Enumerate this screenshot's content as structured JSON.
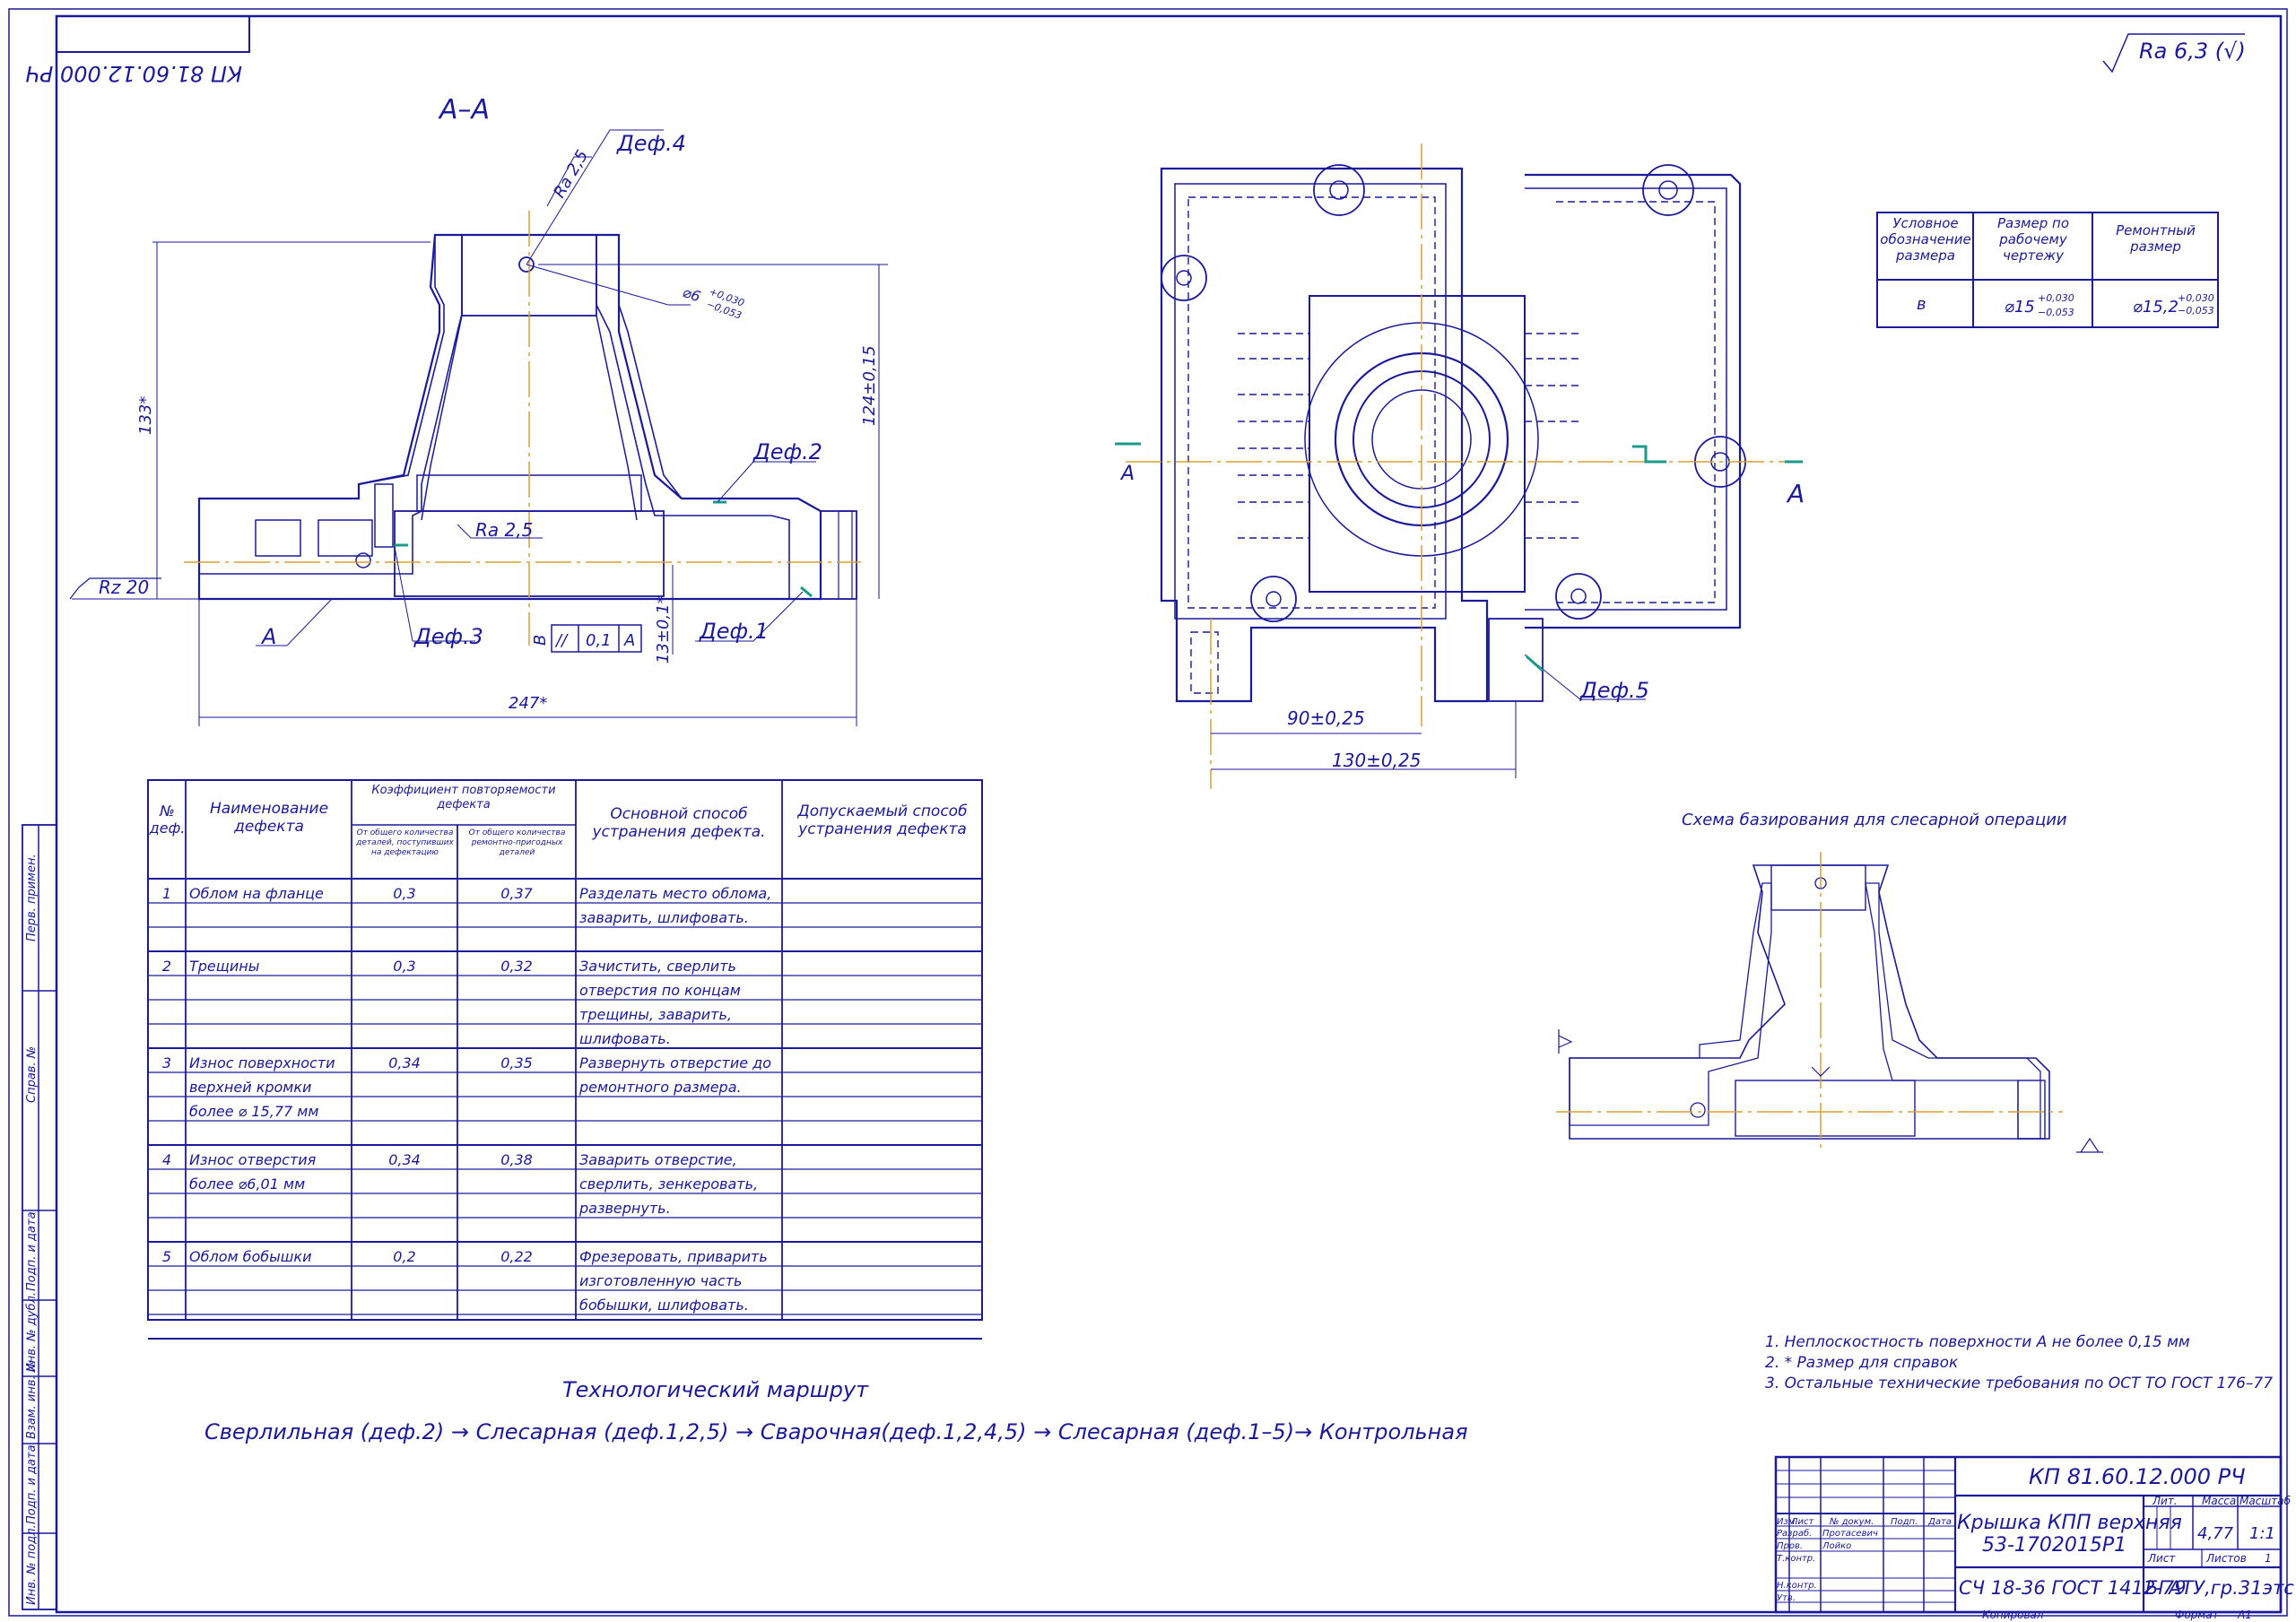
{
  "sheet": {
    "stamp_code_rotated": "КП 81.60.12.000 РЧ",
    "roughness_general": "Ra 6,3 (√)",
    "section_label": "А–А",
    "view_arrow_label": "А"
  },
  "section_view": {
    "def4": "Деф.4",
    "ra25_top": "Ra 2,5",
    "hole_dim": "⌀6",
    "hole_tol_up": "+0,030",
    "hole_tol_dn": "−0,053",
    "dim_133": "133*",
    "dim_124": "124±0,15",
    "def2": "Деф.2",
    "ra25_mid": "Ra 2,5",
    "rz20": "Rz 20",
    "base_a": "А",
    "def3": "Деф.3",
    "base_b": "В",
    "tol_sym": "//",
    "tol_val": "0,1",
    "tol_base": "А",
    "dim_13": "13±0,1*",
    "def1": "Деф.1",
    "dim_247": "247*"
  },
  "plan_view": {
    "dim_90": "90±0,25",
    "dim_130": "130±0,25",
    "def5": "Деф.5",
    "arrow_a_left": "А",
    "arrow_a_right": "А"
  },
  "size_table": {
    "headers": [
      "Условное обозначение размера",
      "Размер по рабочему чертежу",
      "Ремонтный размер"
    ],
    "row": {
      "symbol": "в",
      "work": "⌀15",
      "work_up": "+0,030",
      "work_dn": "−0,053",
      "repair": "⌀15,2",
      "repair_up": "+0,030",
      "repair_dn": "−0,053"
    }
  },
  "defect_table": {
    "h_no": "№ деф.",
    "h_name": "Наименование дефекта",
    "h_coef": "Коэффициент повторяемости дефекта",
    "h_coef_a": "От общего количества деталей, поступивших на дефектацию",
    "h_coef_b": "От общего количества ремонтно-пригодных деталей",
    "h_main": "Основной способ устранения дефекта.",
    "h_allowed": "Допускаемый способ устранения дефекта",
    "rows": [
      {
        "no": "1",
        "name": "Облом на фланце",
        "a": "0,3",
        "b": "0,37",
        "fix": "Разделать место облома, заварить, шлифовать."
      },
      {
        "no": "2",
        "name": "Трещины",
        "a": "0,3",
        "b": "0,32",
        "fix": "Зачистить, сверлить отверстия по концам трещины, заварить, шлифовать."
      },
      {
        "no": "3",
        "name": "Износ поверхности верхней кромки более ⌀ 15,77 мм",
        "a": "0,34",
        "b": "0,35",
        "fix": "Развернуть отверстие до ремонтного размера."
      },
      {
        "no": "4",
        "name": "Износ отверстия более ⌀6,01 мм",
        "a": "0,34",
        "b": "0,38",
        "fix": "Заварить отверстие, сверлить, зенкеровать, развернуть."
      },
      {
        "no": "5",
        "name": "Облом бобышки",
        "a": "0,2",
        "b": "0,22",
        "fix": "Фрезеровать, приварить изготовленную часть бобышки, шлифовать."
      }
    ]
  },
  "route": {
    "title": "Технологический маршрут",
    "text": "Сверлильная (деф.2) → Слесарная (деф.1,2,5) → Сварочная(деф.1,2,4,5) → Слесарная (деф.1–5)→ Контрольная"
  },
  "scheme": {
    "title": "Схема базирования для слесарной операции"
  },
  "notes": [
    "1. Неплоскостность поверхности А не более 0,15 мм",
    "2. * Размер для справок",
    "3. Остальные технические требования по ОСТ ТО ГОСТ 176–77"
  ],
  "side_strip": [
    "Перв. примен.",
    "Справ. №",
    "Подп. и дата",
    "Инв. № дубл.",
    "Взам. инв. №",
    "Подп. и дата",
    "Инв. № подл."
  ],
  "title_block": {
    "code": "КП 81.60.12.000 РЧ",
    "name_line1": "Крышка КПП верхняя",
    "name_line2": "53-1702015Р1",
    "material": "СЧ 18-36 ГОСТ 1412-79",
    "org": "БГАТУ,гр.31этс",
    "lit_label": "Лит.",
    "mass_label": "Масса",
    "scale_label": "Масштаб",
    "mass": "4,77",
    "scale": "1:1",
    "sheet_label": "Лист",
    "sheets_label": "Листов",
    "sheets": "1",
    "col_izm": "Изм.",
    "col_list": "Лист",
    "col_doc": "№ докум.",
    "col_sign": "Подп.",
    "col_date": "Дата",
    "r_razrab": "Разраб.",
    "razrab_name": "Протасевич",
    "r_prov": "Пров.",
    "prov_name": "Лойко",
    "r_tkontr": "Т.контр.",
    "r_nkontr": "Н.контр.",
    "r_utv": "Утв.",
    "copied": "Копировал",
    "format_label": "Формат",
    "format": "А1"
  },
  "colors": {
    "ink": "#1a1a9a",
    "axis": "#d9a030",
    "mark": "#1a9a8a"
  }
}
